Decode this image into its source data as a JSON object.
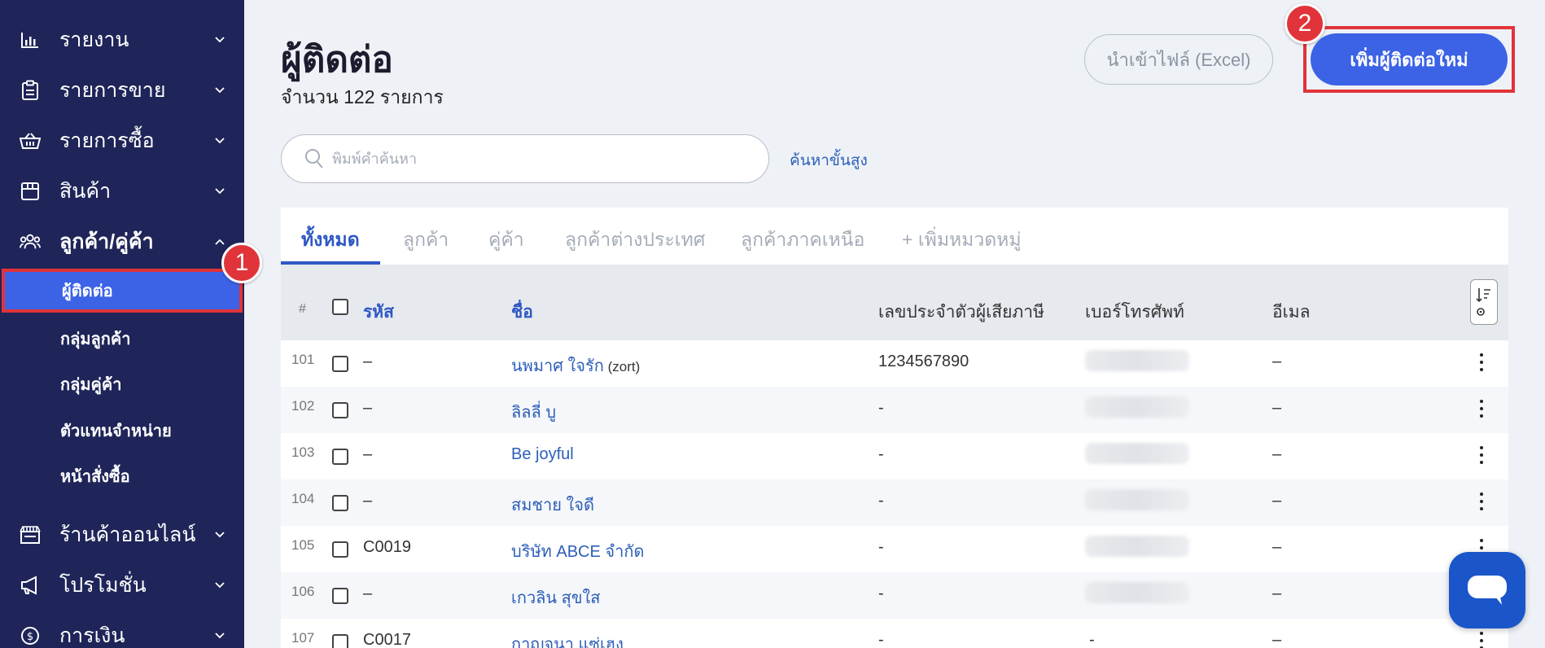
{
  "sidebar": {
    "items": [
      {
        "label": "รายงาน",
        "icon": "bar-chart-icon"
      },
      {
        "label": "รายการขาย",
        "icon": "clipboard-icon"
      },
      {
        "label": "รายการซื้อ",
        "icon": "basket-icon"
      },
      {
        "label": "สินค้า",
        "icon": "box-icon"
      },
      {
        "label": "ลูกค้า/คู่ค้า",
        "icon": "users-icon",
        "expanded": true
      },
      {
        "label": "ร้านค้าออนไลน์",
        "icon": "storefront-icon"
      },
      {
        "label": "โปรโมชั่น",
        "icon": "megaphone-icon"
      },
      {
        "label": "การเงิน",
        "icon": "dollar-circle-icon"
      }
    ],
    "sub_items": [
      {
        "label": "ผู้ติดต่อ",
        "active": true
      },
      {
        "label": "กลุ่มลูกค้า"
      },
      {
        "label": "กลุ่มคู่ค้า"
      },
      {
        "label": "ตัวแทนจำหน่าย"
      },
      {
        "label": "หน้าสั่งซื้อ"
      }
    ]
  },
  "annotations": {
    "step1": "1",
    "step2": "2"
  },
  "header": {
    "title": "ผู้ติดต่อ",
    "count": "จำนวน 122 รายการ",
    "import_label": "นำเข้าไฟล์ (Excel)",
    "add_label": "เพิ่มผู้ติดต่อใหม่"
  },
  "search": {
    "placeholder": "พิมพ์คำค้นหา",
    "value": "",
    "advanced_label": "ค้นหาขั้นสูง"
  },
  "tabs": [
    {
      "label": "ทั้งหมด",
      "active": true
    },
    {
      "label": "ลูกค้า"
    },
    {
      "label": "คู่ค้า"
    },
    {
      "label": "ลูกค้าต่างประเทศ"
    },
    {
      "label": "ลูกค้าภาคเหนือ"
    },
    {
      "label": "+ เพิ่มหมวดหมู่"
    }
  ],
  "table": {
    "columns": {
      "hash": "#",
      "code": "รหัส",
      "name": "ชื่อ",
      "tax_id": "เลขประจำตัวผู้เสียภาษี",
      "phone": "เบอร์โทรศัพท์",
      "email": "อีเมล"
    },
    "rows": [
      {
        "num": "101",
        "code": "–",
        "name": "นพมาศ ใจรัก",
        "name_suffix": " (zort)",
        "tax_id": "1234567890",
        "phone": "",
        "email": "–"
      },
      {
        "num": "102",
        "code": "–",
        "name": "ลิลลี่ บู",
        "name_suffix": "",
        "tax_id": "-",
        "phone": "",
        "email": "–"
      },
      {
        "num": "103",
        "code": "–",
        "name": "Be joyful",
        "name_suffix": "",
        "tax_id": "-",
        "phone": "",
        "email": "–"
      },
      {
        "num": "104",
        "code": "–",
        "name": "สมชาย ใจดี",
        "name_suffix": "",
        "tax_id": "-",
        "phone": "",
        "email": "–"
      },
      {
        "num": "105",
        "code": "C0019",
        "name": "บริษัท ABCE จำกัด",
        "name_suffix": "",
        "tax_id": "-",
        "phone": "",
        "email": "–"
      },
      {
        "num": "106",
        "code": "–",
        "name": "เกวลิน สุขใส",
        "name_suffix": "",
        "tax_id": "-",
        "phone": "",
        "email": "–"
      },
      {
        "num": "107",
        "code": "C0017",
        "name": "กาญจนา แซ่เฮง",
        "name_suffix": "",
        "tax_id": "-",
        "phone": "-",
        "email": "–"
      }
    ]
  },
  "colors": {
    "sidebar_bg": "#1f2559",
    "accent": "#3c63e6",
    "annotation_red": "#e0343a",
    "link_blue": "#2c5eb8"
  }
}
